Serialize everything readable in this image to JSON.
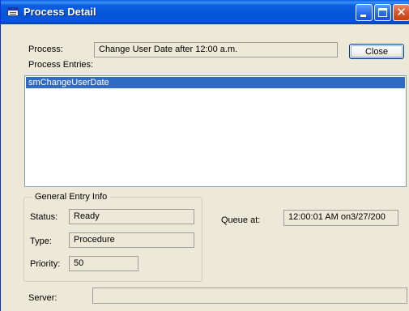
{
  "window": {
    "title": "Process Detail",
    "minimize_icon": "minimize-icon",
    "maximize_icon": "maximize-icon",
    "close_icon": "close-icon"
  },
  "process": {
    "label": "Process:",
    "value": "Change User Date after 12:00 a.m."
  },
  "close_button": {
    "label": "Close"
  },
  "entries": {
    "label": "Process Entries:",
    "items": [
      {
        "text": "smChangeUserDate",
        "selected": true
      }
    ]
  },
  "general_info": {
    "legend": "General Entry Info",
    "status_label": "Status:",
    "status_value": "Ready",
    "type_label": "Type:",
    "type_value": "Procedure",
    "priority_label": "Priority:",
    "priority_value": "50"
  },
  "queue": {
    "label": "Queue at:",
    "value": "12:00:01 AM on3/27/200"
  },
  "server": {
    "label": "Server:",
    "value": ""
  },
  "colors": {
    "titlebar": "#0455d6",
    "selection": "#316ac5",
    "dialog_bg": "#ece9d8"
  }
}
